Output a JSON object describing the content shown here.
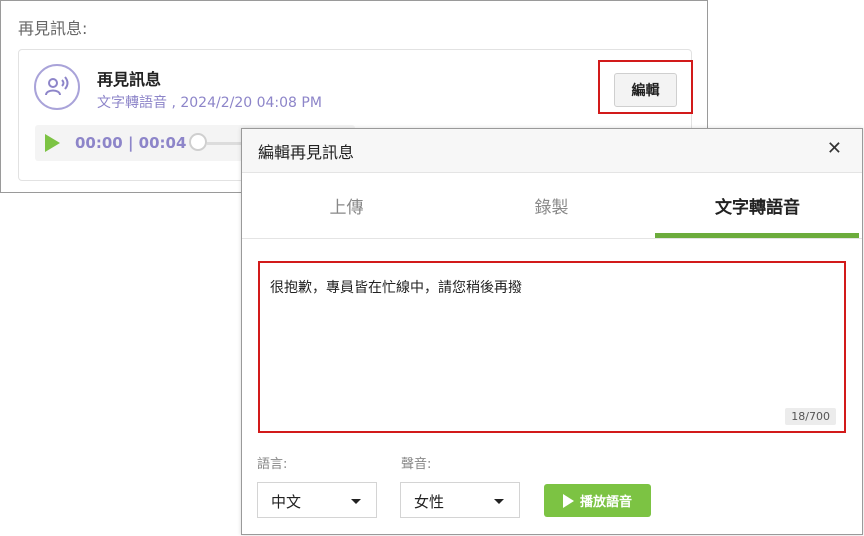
{
  "back_panel": {
    "section_title": "再見訊息:",
    "message": {
      "name": "再見訊息",
      "meta": "文字轉語音 , 2024/2/20 04:08 PM",
      "edit_label": "編輯",
      "player": {
        "time": "00:00 | 00:04",
        "progress": 0
      }
    }
  },
  "modal": {
    "title": "編輯再見訊息",
    "close": "✕",
    "tabs": [
      {
        "label": "上傳",
        "active": false
      },
      {
        "label": "錄製",
        "active": false
      },
      {
        "label": "文字轉語音",
        "active": true
      }
    ],
    "text": {
      "value": "很抱歉，專員皆在忙線中，請您稍後再撥",
      "counter": "18/700"
    },
    "language": {
      "label": "語言:",
      "value": "中文"
    },
    "voice": {
      "label": "聲音:",
      "value": "女性"
    },
    "play_button": "播放語音"
  },
  "colors": {
    "accent_green": "#7cc343",
    "tab_underline": "#6cac3c",
    "highlight_red": "#d21a1a",
    "meta_purple": "#8d85c9"
  },
  "icons": [
    "user-voice-icon",
    "play-icon",
    "close-icon",
    "chevron-down-icon"
  ]
}
